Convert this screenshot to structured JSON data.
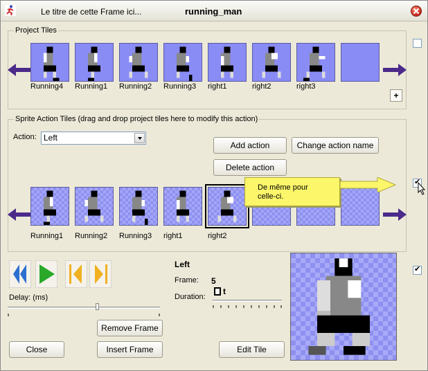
{
  "window": {
    "title_left": "Le titre de cette Frame ici...",
    "title_main": "running_man"
  },
  "project_tiles": {
    "legend": "Project Tiles",
    "labels": [
      "Running4",
      "Running1",
      "Running2",
      "Running3",
      "right1",
      "right2",
      "right3"
    ],
    "add_label": "+"
  },
  "sprite_action": {
    "legend": "Sprite Action Tiles (drag and drop project tiles here to modify this action)",
    "action_label": "Action:",
    "action_value": "Left",
    "add_action": "Add action",
    "change_action_name": "Change action name",
    "delete_action": "Delete action",
    "tile_labels": [
      "Running1",
      "Running2",
      "Running3",
      "right1",
      "right2"
    ]
  },
  "tooltip": {
    "text_line1": "De même pour",
    "text_line2": "celle-ci."
  },
  "frame_info": {
    "action_name": "Left",
    "frame_label": "Frame:",
    "frame_value": "5",
    "duration_label": "Duration:",
    "duration_value": "t",
    "delay_label": "Delay: (ms)"
  },
  "buttons": {
    "remove_frame": "Remove Frame",
    "insert_frame": "Insert Frame",
    "close": "Close",
    "edit_tile": "Edit Tile"
  },
  "colors": {
    "tile_bg": "#8a8cf5",
    "arrow": "#4b2a8a",
    "play": "#2aa82a",
    "rewind": "#2b6fcf",
    "step": "#f0b020",
    "tooltip_bg": "#fbf66a"
  }
}
